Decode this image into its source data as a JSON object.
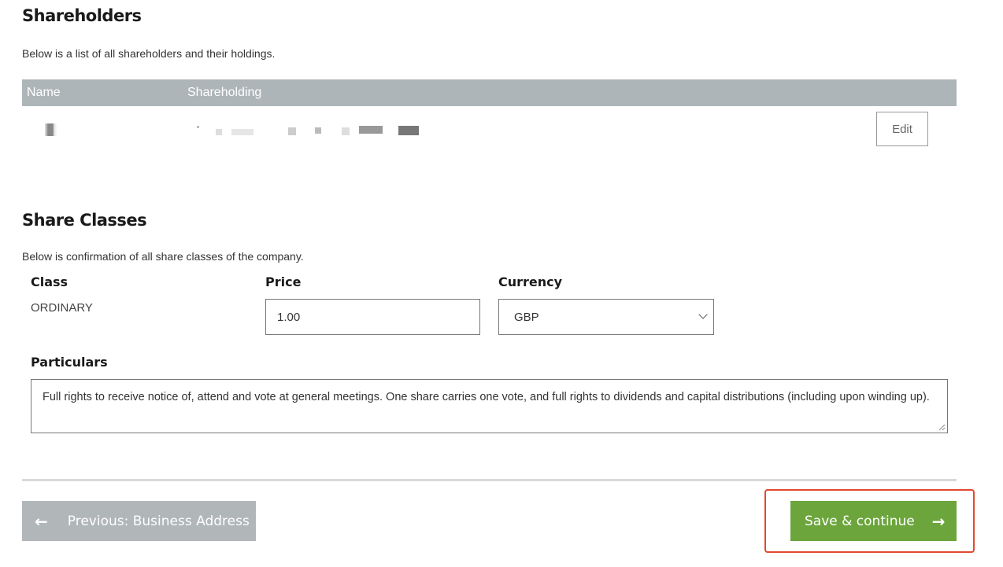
{
  "shareholders": {
    "title": "Shareholders",
    "intro": "Below is a list of all shareholders and their holdings.",
    "columns": [
      "Name",
      "Shareholding"
    ],
    "rows": [
      {
        "name": "",
        "shareholding": "",
        "edit_label": "Edit"
      }
    ]
  },
  "share_classes": {
    "title": "Share Classes",
    "intro": "Below is confirmation of all share classes of the company.",
    "class_label": "Class",
    "price_label": "Price",
    "currency_label": "Currency",
    "class_value": "ORDINARY",
    "price_value": "1.00",
    "currency_value": "GBP",
    "particulars_label": "Particulars",
    "particulars_value": "Full rights to receive notice of, attend and vote at general meetings. One share carries one vote, and full rights to dividends and capital distributions (including upon winding up)."
  },
  "nav": {
    "prev_arrow": "←",
    "prev_label": "Previous: Business Address",
    "save_label": "Save & continue",
    "save_arrow": "→"
  },
  "colors": {
    "table_header": "#aeb5b8",
    "save_button": "#6ba53c",
    "prev_button": "#b1b6b9",
    "highlight": "#e2492f"
  }
}
